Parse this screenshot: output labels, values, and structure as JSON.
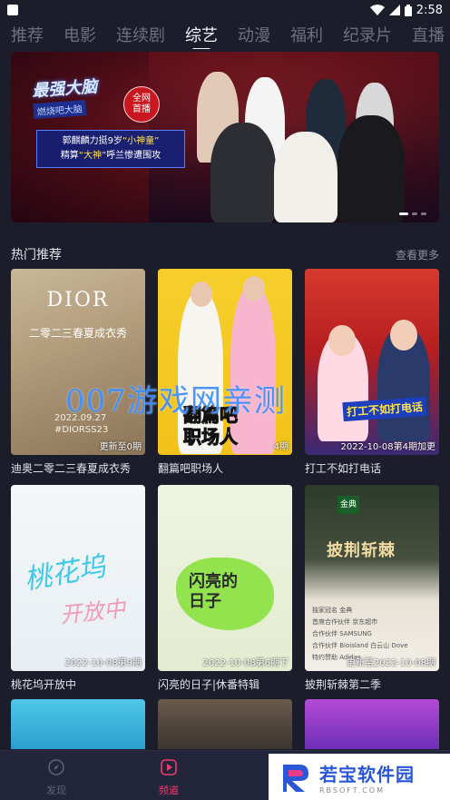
{
  "status_bar": {
    "time": "2:58"
  },
  "tabs": [
    {
      "label": "推荐",
      "active": false
    },
    {
      "label": "电影",
      "active": false
    },
    {
      "label": "连续剧",
      "active": false
    },
    {
      "label": "综艺",
      "active": true
    },
    {
      "label": "动漫",
      "active": false
    },
    {
      "label": "福利",
      "active": false
    },
    {
      "label": "纪录片",
      "active": false
    },
    {
      "label": "直播",
      "active": false
    }
  ],
  "banner": {
    "logo_title": "最强大脑",
    "logo_subtitle": "燃烧吧大脑",
    "badge_line1": "全网",
    "badge_line2": "首播",
    "caption_line1_a": "郭麒麟力挺9岁",
    "caption_line1_b": "“小神童”",
    "caption_line2_a": "精算",
    "caption_line2_b": "“大神”",
    "caption_line2_c": "呼兰惨遭围攻"
  },
  "section": {
    "title": "热门推荐",
    "more": "查看更多"
  },
  "cards": [
    {
      "title": "迪奥二零二三春夏成衣秀",
      "tag": "更新至0期",
      "poster_brand": "DIOR",
      "poster_sub": "二零二三春夏成衣秀",
      "poster_date": "2022.09.27",
      "poster_code": "#DIORSS23"
    },
    {
      "title": "翻篇吧职场人",
      "tag": "4期",
      "poster_name_1": "翻篇吧",
      "poster_name_2": "职场人"
    },
    {
      "title": "打工不如打电话",
      "tag": "2022-10-08第4期加更",
      "poster_logo": "打工不如打电话"
    },
    {
      "title": "桃花坞开放中",
      "tag": "2022-10-08第9期",
      "poster_text_1": "桃花坞",
      "poster_text_2": "开放中"
    },
    {
      "title": "闪亮的日子|休番特辑",
      "tag": "2022-10-08第6期下",
      "poster_text_1": "闪亮的",
      "poster_text_2": "日子"
    },
    {
      "title": "披荆斩棘第二季",
      "tag": "更新至2022-10-08期",
      "poster_title": "披荆斩棘",
      "poster_sponsor": "金典",
      "poster_rows": [
        "独家冠名 金典",
        "首席合作伙伴 京东超市",
        "合作伙伴 SAMSUNG",
        "合作伙伴 Bioisland 白云山 Dove",
        "特约赞助 Adidas"
      ]
    }
  ],
  "watermark": "007游戏网亲测",
  "bottom_nav": [
    {
      "label": "发现",
      "active": false
    },
    {
      "label": "频道",
      "active": true
    }
  ],
  "site_badge": {
    "name": "若宝软件园",
    "domain": "RBSOFT.COM"
  },
  "colors": {
    "accent": "#ec3c6f",
    "background": "#1b1d2b",
    "watermark": "#3c8cff"
  }
}
